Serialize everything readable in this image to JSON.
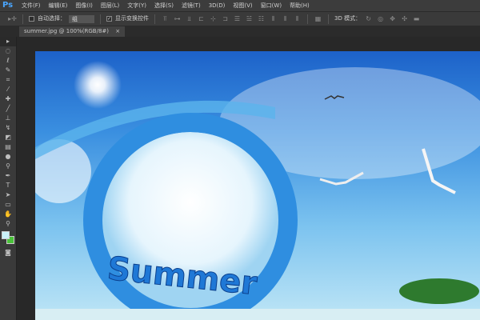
{
  "app": {
    "logo": "Ps"
  },
  "menu": [
    "文件(F)",
    "编辑(E)",
    "图像(I)",
    "图层(L)",
    "文字(Y)",
    "选择(S)",
    "滤镜(T)",
    "3D(D)",
    "视图(V)",
    "窗口(W)",
    "帮助(H)"
  ],
  "options": {
    "auto_select_label": "自动选择：",
    "auto_select_value": "组",
    "show_transform_label": "显示变换控件",
    "mode3d_label": "3D 模式："
  },
  "document": {
    "tab_title": "summer.jpg @ 100%(RGB/8#)",
    "close": "×"
  },
  "image": {
    "text": "Summer"
  },
  "colors": {
    "foreground": "#c8f0f8",
    "background": "#4ac23a"
  }
}
